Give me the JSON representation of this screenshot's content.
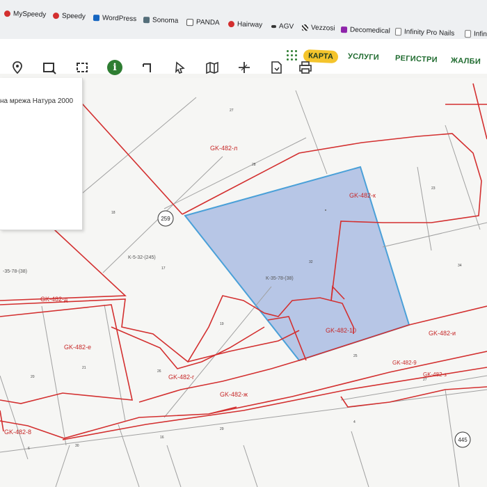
{
  "bookmarks": [
    {
      "label": "MySpeedy",
      "icon": "speedy-icon",
      "color": "#d32f2f"
    },
    {
      "label": "Speedy",
      "icon": "speedy-icon",
      "color": "#d32f2f"
    },
    {
      "label": "WordPress",
      "icon": "wordpress-icon",
      "color": "#1565c0"
    },
    {
      "label": "Sonoma",
      "icon": "sonoma-icon",
      "color": "#546e7a"
    },
    {
      "label": "PANDA",
      "icon": "panda-icon",
      "color": "#555555"
    },
    {
      "label": "Hairway",
      "icon": "hairway-icon",
      "color": "#d32f2f"
    },
    {
      "label": "AGV",
      "icon": "agv-icon",
      "color": "#333333"
    },
    {
      "label": "Vezzosi",
      "icon": "vezzosi-icon",
      "color": "#333333"
    },
    {
      "label": "Decomedical",
      "icon": "decomedical-icon",
      "color": "#8e24aa"
    },
    {
      "label": "Infinity Pro Nails",
      "icon": "document-icon",
      "color": "#777777"
    },
    {
      "label": "Infinit",
      "icon": "document-icon",
      "color": "#777777"
    }
  ],
  "nav": {
    "map": "КАРТА",
    "services": "УСЛУГИ",
    "registers": "РЕГИСТРИ",
    "complaints": "ЖАЛБИ",
    "accent_color": "#f4c42c",
    "link_color": "#1f6b2f"
  },
  "toolbar": {
    "tools": [
      "location-pin-icon",
      "rectangle-select-icon",
      "rectangle-dashed-icon",
      "info-icon",
      "measure-angle-icon",
      "pointer-icon",
      "map-layers-icon",
      "coordinate-axes-icon",
      "export-icon",
      "print-icon"
    ],
    "info_label": "i"
  },
  "info_panel": {
    "text": "на мрежа Натура 2000"
  },
  "map": {
    "selected_fill": "#b7c6e6",
    "selected_stroke": "#4aa0d8",
    "boundary_color": "#d32f2f",
    "parcel_line_color": "#9a9a9a",
    "labels": {
      "gk482l": "GK-482-л",
      "gk482k": "GK-482-к",
      "k3578_center": "K-35-78-(38)",
      "k3578_left": "-35-78-(38)",
      "k532": "K-5-32-(245)",
      "gk482_10": "GK-482-10",
      "gk482d": "GK-482-д",
      "gk482e": "GK-482-е",
      "gk482g": "GK-482-г",
      "gk482i": "GK-482-и",
      "gk482_9": "GK-482-9",
      "gk482z": "GK-482-з",
      "gk482zh": "GK-482-ж",
      "gk482_8": "GK-482-8"
    },
    "circle_labels": {
      "c259": "259",
      "c445": "445"
    },
    "parcel_numbers": {
      "n27": "27",
      "n28": "28",
      "n23": "23",
      "n18": "18",
      "n32": "32",
      "n34": "34",
      "n17": "17",
      "n19": "19",
      "n20": "20",
      "n21": "21",
      "n25": "25",
      "n26": "26",
      "n27b": "27",
      "n29": "29",
      "n30": "30",
      "n16": "16",
      "n4": "4",
      "n6": "6"
    }
  }
}
